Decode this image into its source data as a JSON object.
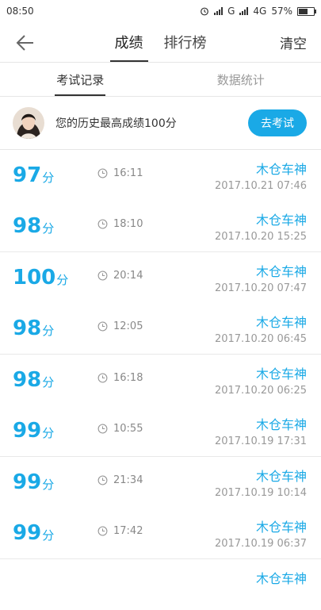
{
  "status_bar": {
    "time": "08:50",
    "net1": "G",
    "net2": "4G",
    "battery": "57%",
    "battery_level": 0.57
  },
  "nav": {
    "tabs": [
      {
        "label": "成绩",
        "active": true
      },
      {
        "label": "排行榜",
        "active": false
      }
    ],
    "clear_label": "清空"
  },
  "subtabs": [
    {
      "label": "考试记录",
      "active": true
    },
    {
      "label": "数据统计",
      "active": false
    }
  ],
  "best": {
    "text": "您的历史最高成绩100分",
    "button": "去考试"
  },
  "accent_color": "#1aa9e6",
  "score_unit": "分",
  "records": [
    {
      "score": "97",
      "duration": "16:11",
      "user": "木仓车神",
      "date": "2017.10.21  07:46"
    },
    {
      "score": "98",
      "duration": "18:10",
      "user": "木仓车神",
      "date": "2017.10.20  15:25"
    },
    {
      "score": "100",
      "duration": "20:14",
      "user": "木仓车神",
      "date": "2017.10.20  07:47"
    },
    {
      "score": "98",
      "duration": "12:05",
      "user": "木仓车神",
      "date": "2017.10.20  06:45"
    },
    {
      "score": "98",
      "duration": "16:18",
      "user": "木仓车神",
      "date": "2017.10.20  06:25"
    },
    {
      "score": "99",
      "duration": "10:55",
      "user": "木仓车神",
      "date": "2017.10.19  17:31"
    },
    {
      "score": "99",
      "duration": "21:34",
      "user": "木仓车神",
      "date": "2017.10.19  10:14"
    },
    {
      "score": "99",
      "duration": "17:42",
      "user": "木仓车神",
      "date": "2017.10.19  06:37"
    },
    {
      "score": "",
      "duration": "",
      "user": "木仓车神",
      "date": ""
    }
  ]
}
